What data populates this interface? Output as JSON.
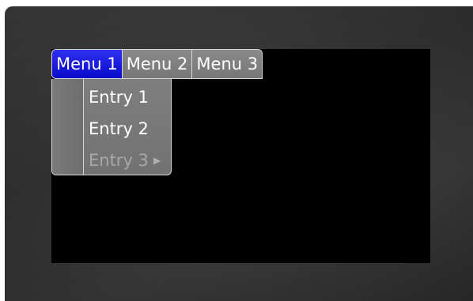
{
  "menubar": {
    "menus": [
      {
        "label": "Menu 1",
        "active": true
      },
      {
        "label": "Menu 2",
        "active": false
      },
      {
        "label": "Menu 3",
        "active": false
      }
    ]
  },
  "dropdown": {
    "entries": [
      {
        "label": "Entry 1",
        "enabled": true,
        "has_submenu": false
      },
      {
        "label": "Entry 2",
        "enabled": true,
        "has_submenu": false
      },
      {
        "label": "Entry 3",
        "enabled": false,
        "has_submenu": true
      }
    ],
    "submenu_arrow_icon": "triangle-right-icon"
  },
  "colors": {
    "active_menu": "#1010dd",
    "menu_background": "#808080",
    "screen": "#000000",
    "bezel": "#333333",
    "disabled_text": "#a8a8a8"
  }
}
